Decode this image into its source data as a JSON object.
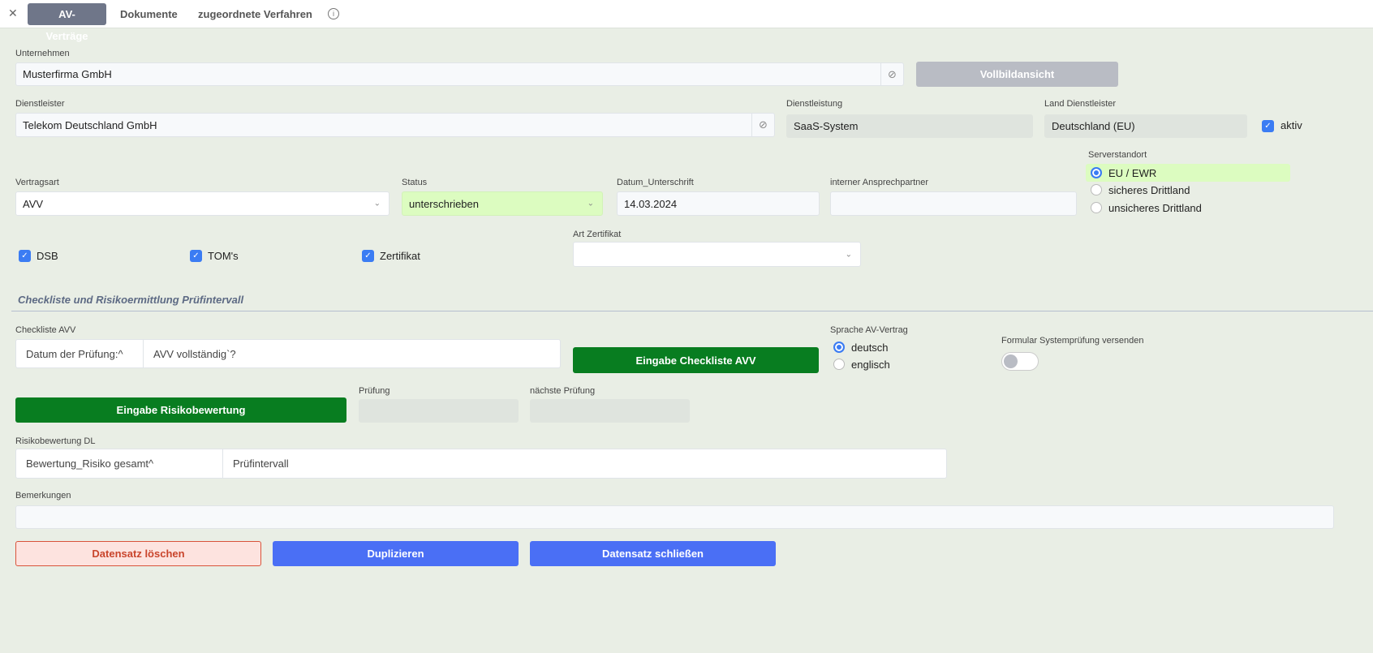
{
  "tabs": {
    "close": "✕",
    "items": [
      "AV-Verträge",
      "Dokumente",
      "zugeordnete Verfahren"
    ],
    "info": "i"
  },
  "unternehmen": {
    "label": "Unternehmen",
    "value": "Musterfirma GmbH"
  },
  "vollbild": "Vollbildansicht",
  "dienstleister": {
    "label": "Dienstleister",
    "value": "Telekom Deutschland GmbH"
  },
  "dienstleistung": {
    "label": "Dienstleistung",
    "value": "SaaS-System"
  },
  "land": {
    "label": "Land Dienstleister",
    "value": "Deutschland (EU)"
  },
  "aktiv": "aktiv",
  "serverstandort": {
    "label": "Serverstandort",
    "options": [
      "EU / EWR",
      "sicheres Drittland",
      "unsicheres Drittland"
    ],
    "selected": 0
  },
  "vertragsart": {
    "label": "Vertragsart",
    "value": "AVV"
  },
  "status": {
    "label": "Status",
    "value": "unterschrieben"
  },
  "datum": {
    "label": "Datum_Unterschrift",
    "value": "14.03.2024"
  },
  "ansprech": {
    "label": "interner Ansprechpartner",
    "value": ""
  },
  "checks": [
    "DSB",
    "TOM's",
    "Zertifikat"
  ],
  "art_zert": {
    "label": "Art Zertifikat",
    "value": ""
  },
  "section": "Checkliste und Risikoermittlung Prüfintervall",
  "checkliste": {
    "label": "Checkliste AVV",
    "col1": "Datum der Prüfung:^",
    "col2": "AVV vollständig`?"
  },
  "btn_checkliste": "Eingabe Checkliste AVV",
  "sprache": {
    "label": "Sprache AV-Vertrag",
    "options": [
      "deutsch",
      "englisch"
    ],
    "selected": 0
  },
  "formular": {
    "label": "Formular Systemprüfung versenden",
    "on": false
  },
  "btn_risiko": "Eingabe Risikobewertung",
  "pruefung": {
    "label": "Prüfung",
    "value": ""
  },
  "naechste": {
    "label": "nächste Prüfung",
    "value": ""
  },
  "risiko": {
    "label": "Risikobewertung DL",
    "col1": "Bewertung_Risiko gesamt^",
    "col2": "Prüfintervall"
  },
  "bemerkungen": {
    "label": "Bemerkungen",
    "value": ""
  },
  "actions": {
    "delete": "Datensatz löschen",
    "duplicate": "Duplizieren",
    "close": "Datensatz schließen"
  }
}
